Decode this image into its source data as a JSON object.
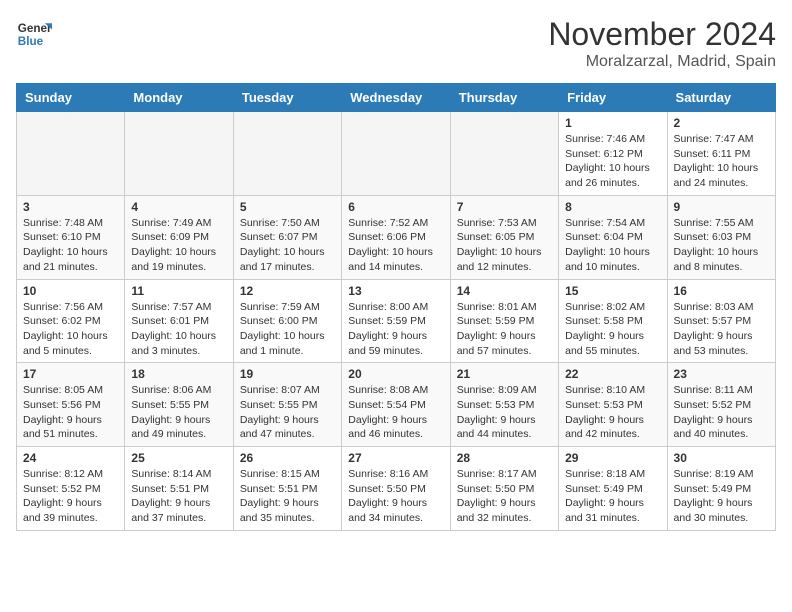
{
  "header": {
    "logo_line1": "General",
    "logo_line2": "Blue",
    "month": "November 2024",
    "location": "Moralzarzal, Madrid, Spain"
  },
  "days_of_week": [
    "Sunday",
    "Monday",
    "Tuesday",
    "Wednesday",
    "Thursday",
    "Friday",
    "Saturday"
  ],
  "weeks": [
    [
      {
        "day": "",
        "info": ""
      },
      {
        "day": "",
        "info": ""
      },
      {
        "day": "",
        "info": ""
      },
      {
        "day": "",
        "info": ""
      },
      {
        "day": "",
        "info": ""
      },
      {
        "day": "1",
        "info": "Sunrise: 7:46 AM\nSunset: 6:12 PM\nDaylight: 10 hours and 26 minutes."
      },
      {
        "day": "2",
        "info": "Sunrise: 7:47 AM\nSunset: 6:11 PM\nDaylight: 10 hours and 24 minutes."
      }
    ],
    [
      {
        "day": "3",
        "info": "Sunrise: 7:48 AM\nSunset: 6:10 PM\nDaylight: 10 hours and 21 minutes."
      },
      {
        "day": "4",
        "info": "Sunrise: 7:49 AM\nSunset: 6:09 PM\nDaylight: 10 hours and 19 minutes."
      },
      {
        "day": "5",
        "info": "Sunrise: 7:50 AM\nSunset: 6:07 PM\nDaylight: 10 hours and 17 minutes."
      },
      {
        "day": "6",
        "info": "Sunrise: 7:52 AM\nSunset: 6:06 PM\nDaylight: 10 hours and 14 minutes."
      },
      {
        "day": "7",
        "info": "Sunrise: 7:53 AM\nSunset: 6:05 PM\nDaylight: 10 hours and 12 minutes."
      },
      {
        "day": "8",
        "info": "Sunrise: 7:54 AM\nSunset: 6:04 PM\nDaylight: 10 hours and 10 minutes."
      },
      {
        "day": "9",
        "info": "Sunrise: 7:55 AM\nSunset: 6:03 PM\nDaylight: 10 hours and 8 minutes."
      }
    ],
    [
      {
        "day": "10",
        "info": "Sunrise: 7:56 AM\nSunset: 6:02 PM\nDaylight: 10 hours and 5 minutes."
      },
      {
        "day": "11",
        "info": "Sunrise: 7:57 AM\nSunset: 6:01 PM\nDaylight: 10 hours and 3 minutes."
      },
      {
        "day": "12",
        "info": "Sunrise: 7:59 AM\nSunset: 6:00 PM\nDaylight: 10 hours and 1 minute."
      },
      {
        "day": "13",
        "info": "Sunrise: 8:00 AM\nSunset: 5:59 PM\nDaylight: 9 hours and 59 minutes."
      },
      {
        "day": "14",
        "info": "Sunrise: 8:01 AM\nSunset: 5:59 PM\nDaylight: 9 hours and 57 minutes."
      },
      {
        "day": "15",
        "info": "Sunrise: 8:02 AM\nSunset: 5:58 PM\nDaylight: 9 hours and 55 minutes."
      },
      {
        "day": "16",
        "info": "Sunrise: 8:03 AM\nSunset: 5:57 PM\nDaylight: 9 hours and 53 minutes."
      }
    ],
    [
      {
        "day": "17",
        "info": "Sunrise: 8:05 AM\nSunset: 5:56 PM\nDaylight: 9 hours and 51 minutes."
      },
      {
        "day": "18",
        "info": "Sunrise: 8:06 AM\nSunset: 5:55 PM\nDaylight: 9 hours and 49 minutes."
      },
      {
        "day": "19",
        "info": "Sunrise: 8:07 AM\nSunset: 5:55 PM\nDaylight: 9 hours and 47 minutes."
      },
      {
        "day": "20",
        "info": "Sunrise: 8:08 AM\nSunset: 5:54 PM\nDaylight: 9 hours and 46 minutes."
      },
      {
        "day": "21",
        "info": "Sunrise: 8:09 AM\nSunset: 5:53 PM\nDaylight: 9 hours and 44 minutes."
      },
      {
        "day": "22",
        "info": "Sunrise: 8:10 AM\nSunset: 5:53 PM\nDaylight: 9 hours and 42 minutes."
      },
      {
        "day": "23",
        "info": "Sunrise: 8:11 AM\nSunset: 5:52 PM\nDaylight: 9 hours and 40 minutes."
      }
    ],
    [
      {
        "day": "24",
        "info": "Sunrise: 8:12 AM\nSunset: 5:52 PM\nDaylight: 9 hours and 39 minutes."
      },
      {
        "day": "25",
        "info": "Sunrise: 8:14 AM\nSunset: 5:51 PM\nDaylight: 9 hours and 37 minutes."
      },
      {
        "day": "26",
        "info": "Sunrise: 8:15 AM\nSunset: 5:51 PM\nDaylight: 9 hours and 35 minutes."
      },
      {
        "day": "27",
        "info": "Sunrise: 8:16 AM\nSunset: 5:50 PM\nDaylight: 9 hours and 34 minutes."
      },
      {
        "day": "28",
        "info": "Sunrise: 8:17 AM\nSunset: 5:50 PM\nDaylight: 9 hours and 32 minutes."
      },
      {
        "day": "29",
        "info": "Sunrise: 8:18 AM\nSunset: 5:49 PM\nDaylight: 9 hours and 31 minutes."
      },
      {
        "day": "30",
        "info": "Sunrise: 8:19 AM\nSunset: 5:49 PM\nDaylight: 9 hours and 30 minutes."
      }
    ]
  ]
}
